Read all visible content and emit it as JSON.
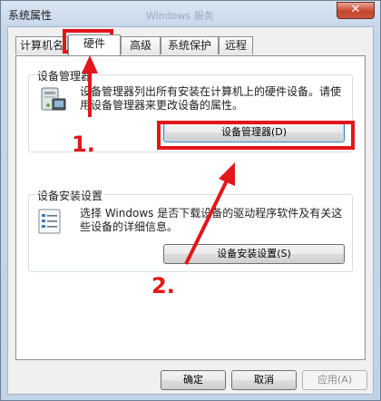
{
  "window": {
    "title": "系统属性",
    "title_ghost": "Windows 服务",
    "close_symbol": "✕"
  },
  "tabs": [
    {
      "label": "计算机名",
      "active": false
    },
    {
      "label": "硬件",
      "active": true
    },
    {
      "label": "高级",
      "active": false
    },
    {
      "label": "系统保护",
      "active": false
    },
    {
      "label": "远程",
      "active": false
    }
  ],
  "device_manager": {
    "group_label": "设备管理器",
    "description": "设备管理器列出所有安装在计算机上的硬件设备。请使用设备管理器来更改设备的属性。",
    "button_label": "设备管理器(D)",
    "icon": "device-manager-icon"
  },
  "device_install": {
    "group_label": "设备安装设置",
    "description": "选择 Windows 是否下载设备的驱动程序软件及有关这些设备的详细信息。",
    "button_label": "设备安装设置(S)",
    "icon": "checklist-icon"
  },
  "footer": {
    "ok_label": "确定",
    "cancel_label": "取消",
    "apply_label": "应用(A)"
  },
  "annotations": {
    "step1": "1.",
    "step2": "2.",
    "color": "#e2161b"
  }
}
